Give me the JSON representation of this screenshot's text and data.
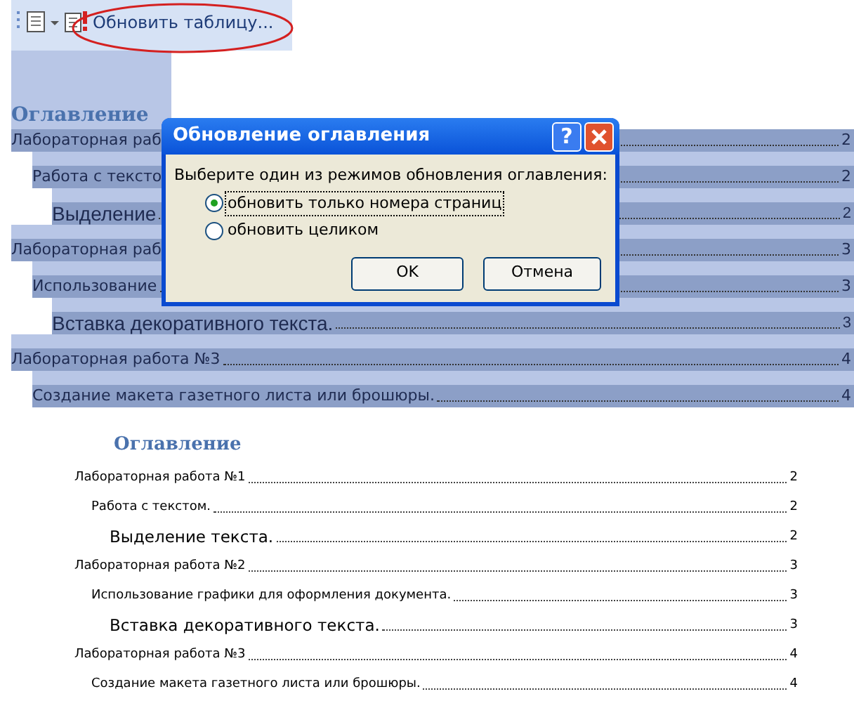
{
  "toolbar": {
    "update_button": "Обновить таблицу..."
  },
  "selected_toc": {
    "heading": "Оглавление",
    "entries": [
      {
        "text": "Лабораторная раб",
        "page": "2",
        "children": [
          {
            "text": "Работа с тексто",
            "page": "2",
            "children": [
              {
                "text": "Выделение",
                "page": "2"
              }
            ]
          }
        ]
      },
      {
        "text": "Лабораторная раб",
        "page": "3",
        "children": [
          {
            "text": "Использование",
            "page": "3",
            "children": [
              {
                "text": "Вставка декоративного текста.",
                "page": "3"
              }
            ]
          }
        ]
      },
      {
        "text": "Лабораторная работа №3",
        "page": "4",
        "children": [
          {
            "text": "Создание макета газетного листа или брошюры.",
            "page": "4"
          }
        ]
      }
    ]
  },
  "toc": {
    "heading": "Оглавление",
    "entries": [
      {
        "text": "Лабораторная работа №1",
        "page": "2",
        "children": [
          {
            "text": "Работа с текстом.",
            "page": "2",
            "children": [
              {
                "text": "Выделение текста.",
                "page": "2"
              }
            ]
          }
        ]
      },
      {
        "text": "Лабораторная работа №2",
        "page": "3",
        "children": [
          {
            "text": "Использование графики для оформления документа.",
            "page": "3",
            "children": [
              {
                "text": "Вставка декоративного текста.",
                "page": "3"
              }
            ]
          }
        ]
      },
      {
        "text": "Лабораторная работа №3",
        "page": "4",
        "children": [
          {
            "text": "Создание макета газетного листа или брошюры.",
            "page": "4"
          }
        ]
      }
    ]
  },
  "dialog": {
    "title": "Обновление оглавления",
    "help_button": "?",
    "prompt": "Выберите один из режимов обновления оглавления:",
    "options": [
      {
        "label": "обновить только номера страниц",
        "selected": true
      },
      {
        "label": "обновить целиком",
        "selected": false
      }
    ],
    "buttons": [
      "OK",
      "Отмена"
    ]
  }
}
